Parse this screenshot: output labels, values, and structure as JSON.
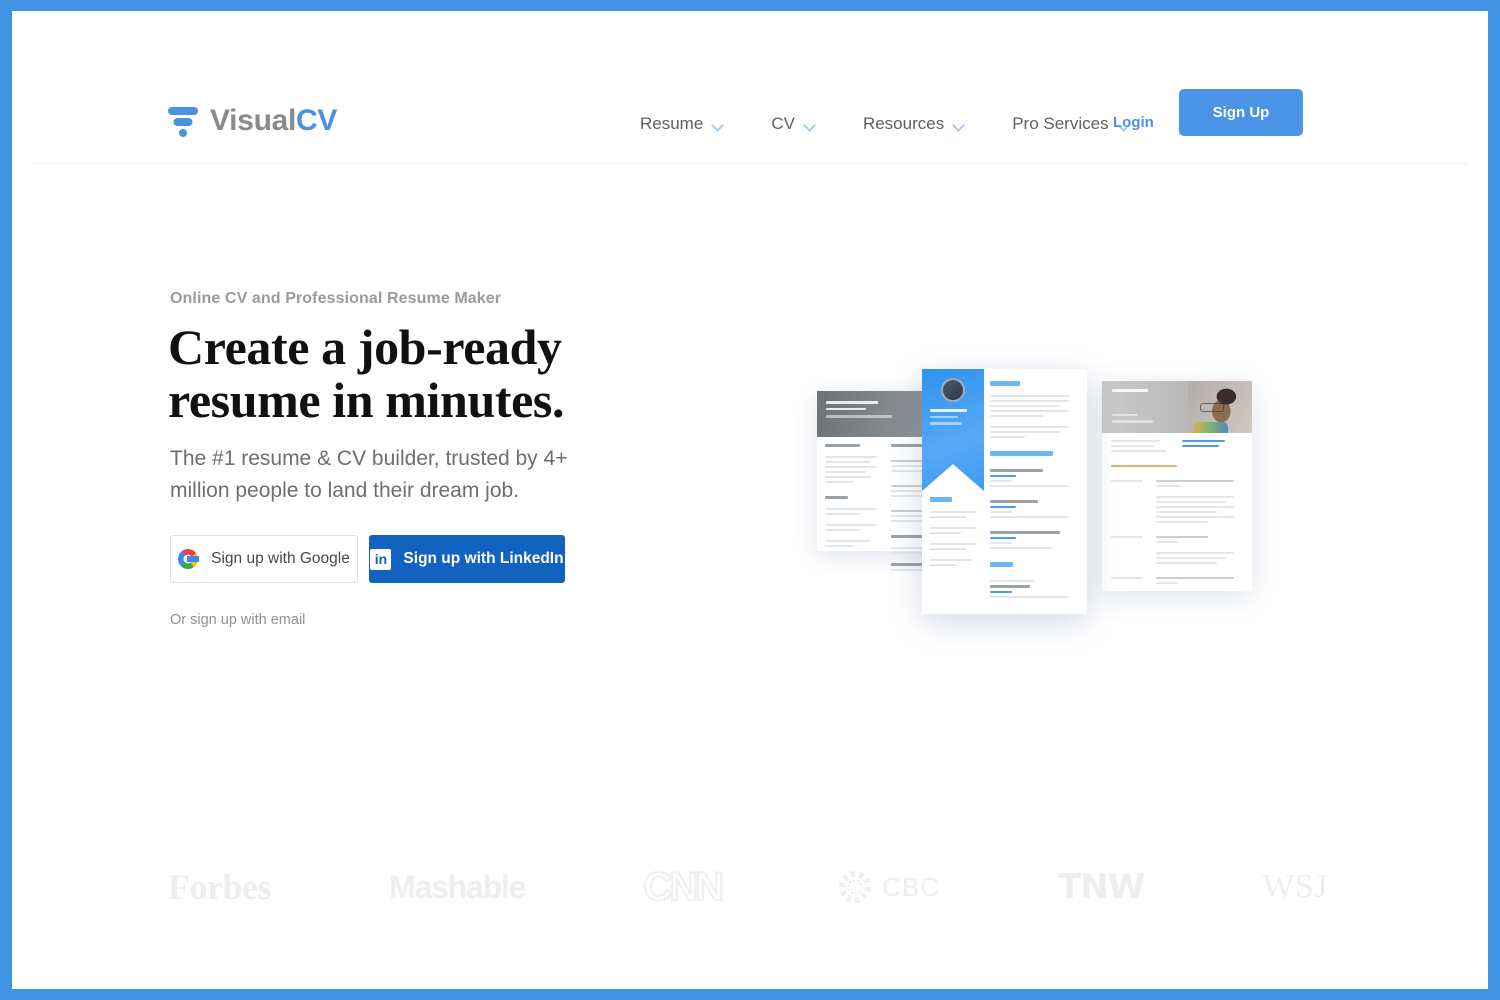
{
  "theme": {
    "frame_border_color": "#4193e4",
    "brand_blue": "#4a91e2",
    "button_blue": "#4a93e5",
    "linkedin_blue": "#1263bf",
    "headline_color": "#111111",
    "body_text_color": "#6b6f73",
    "press_logo_color": "#eeeeee"
  },
  "header": {
    "brand": {
      "logo_icon": "funnel-icon",
      "name_part1": "Visual",
      "name_part2": "CV"
    },
    "nav": [
      {
        "label": "Resume",
        "has_dropdown": true
      },
      {
        "label": "CV",
        "has_dropdown": true
      },
      {
        "label": "Resources",
        "has_dropdown": true
      },
      {
        "label": "Pro Services",
        "has_dropdown": true
      }
    ],
    "login_label": "Login",
    "signup_label": "Sign Up"
  },
  "hero": {
    "eyebrow": "Online CV and Professional Resume Maker",
    "title_line1": "Create a job-ready",
    "title_line2": "resume in minutes.",
    "subtitle": "The #1 resume & CV builder, trusted by 4+ million people to land their dream job.",
    "google_button": {
      "label": "Sign up with Google",
      "icon": "google-g-icon"
    },
    "linkedin_button": {
      "label": "Sign up with LinkedIn",
      "icon": "linkedin-in-icon",
      "icon_text": "in"
    },
    "email_link": "Or sign up with email"
  },
  "hero_art": {
    "description": "Three overlapping resume template mockups",
    "documents": [
      {
        "name": "resume-template-left",
        "header_style": "dark-gray-photo"
      },
      {
        "name": "resume-template-center",
        "header_style": "blue-ribbon-avatar"
      },
      {
        "name": "resume-template-right",
        "header_style": "gray-photo-portrait"
      }
    ]
  },
  "press": {
    "logos": [
      {
        "name": "forbes-logo",
        "label": "Forbes"
      },
      {
        "name": "mashable-logo",
        "label": "Mashable"
      },
      {
        "name": "cnn-logo",
        "label": "CNN"
      },
      {
        "name": "cbc-logo",
        "label": "CBC"
      },
      {
        "name": "tnw-logo",
        "label": "TNW"
      },
      {
        "name": "wsj-logo",
        "label": "WSJ"
      }
    ]
  }
}
